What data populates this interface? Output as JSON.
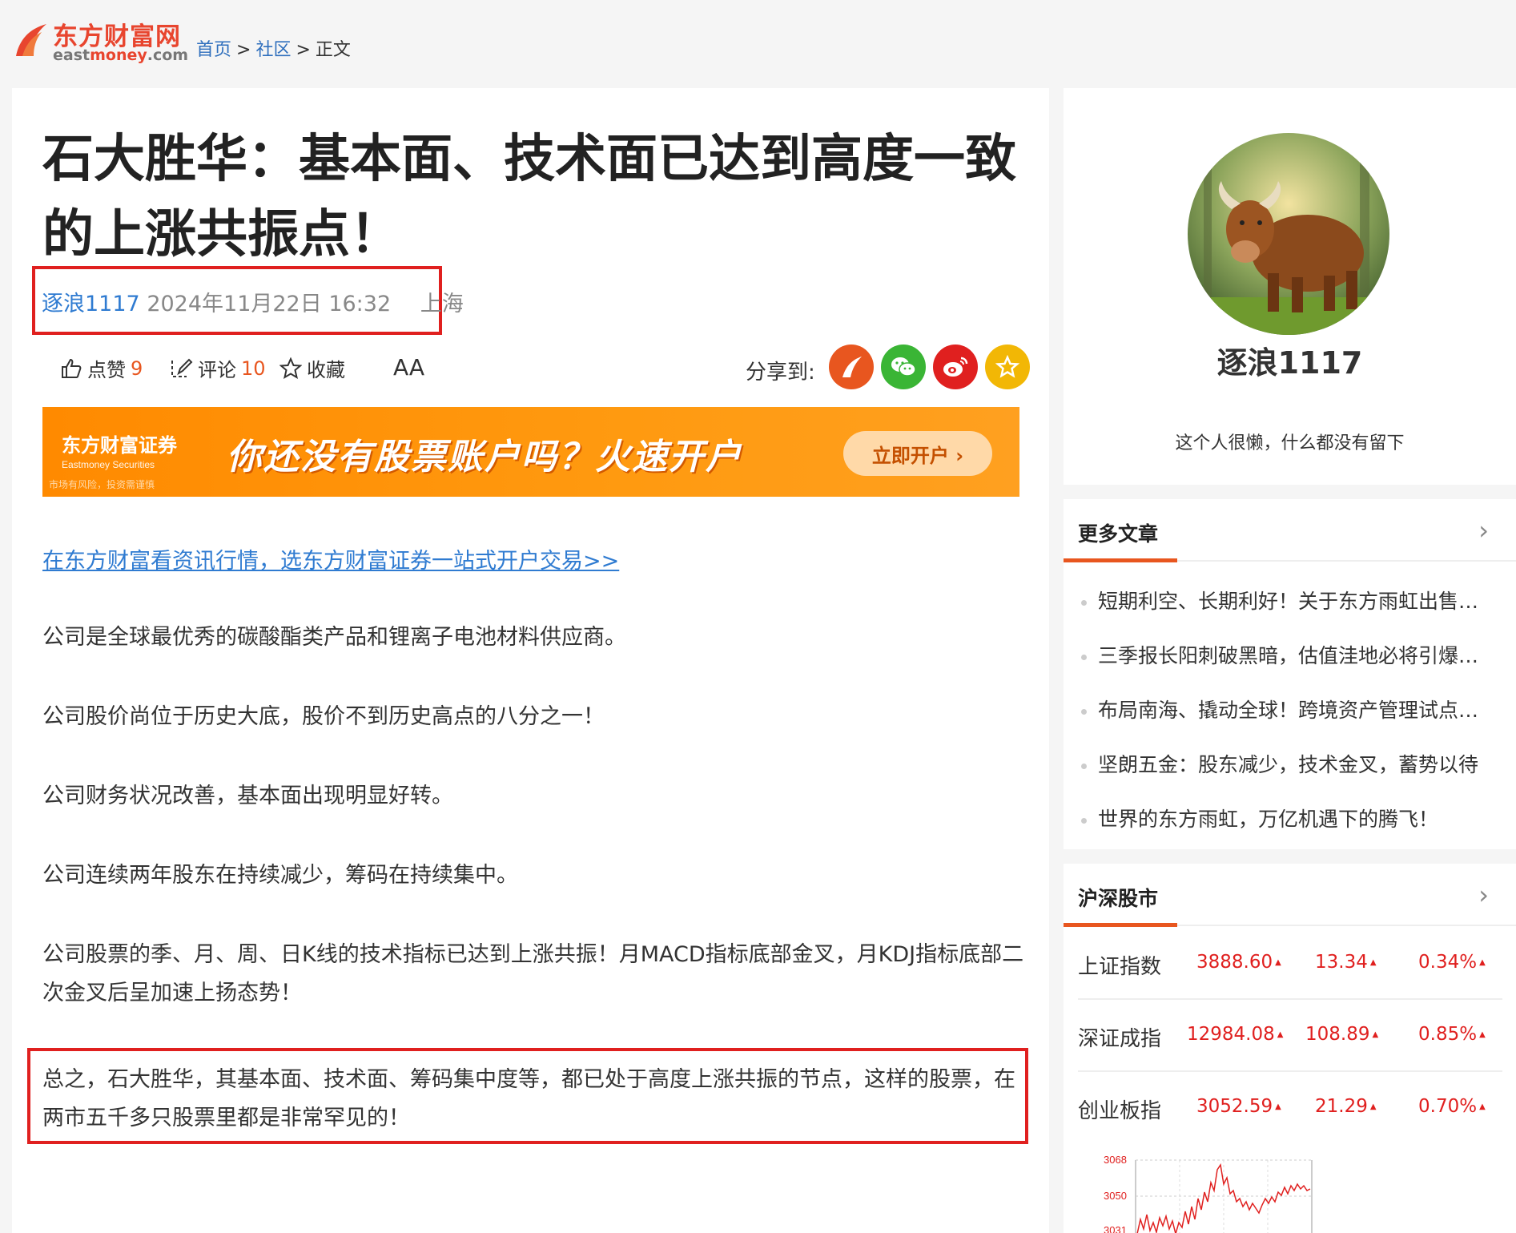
{
  "header": {
    "logo_cn": "东方财富网",
    "logo_en_a": "east",
    "logo_en_b": "money",
    "logo_en_c": ".com",
    "breadcrumb": [
      "首页",
      "社区",
      "正文"
    ]
  },
  "article": {
    "title": "石大胜华：基本面、技术面已达到高度一致的上涨共振点！",
    "author": "逐浪1117",
    "datetime": "2024年11月22日 16:32",
    "location": "上海",
    "actions": {
      "like_label": "点赞",
      "like_count": "9",
      "comment_label": "评论",
      "comment_count": "10",
      "favorite_label": "收藏",
      "font_label": "AA"
    },
    "share_label": "分享到:",
    "banner": {
      "brand": "东方财富证券",
      "brand_en": "Eastmoney Securities",
      "risk": "市场有风险，投资需谨慎",
      "slogan": "你还没有股票账户吗？火速开户",
      "button": "立即开户 ›"
    },
    "promo_link": "在东方财富看资讯行情，选东方财富证券一站式开户交易>>",
    "paragraphs": [
      "公司是全球最优秀的碳酸酯类产品和锂离子电池材料供应商。",
      "公司股价尚位于历史大底，股价不到历史高点的八分之一！",
      "公司财务状况改善，基本面出现明显好转。",
      "公司连续两年股东在持续减少，筹码在持续集中。",
      "公司股票的季、月、周、日K线的技术指标已达到上涨共振！月MACD指标底部金叉，月KDJ指标底部二次金叉后呈加速上扬态势！",
      "总之，石大胜华，其基本面、技术面、筹码集中度等，都已处于高度上涨共振的节点，这样的股票，在两市五千多只股票里都是非常罕见的！"
    ]
  },
  "profile": {
    "name": "逐浪1117",
    "bio": "这个人很懒，什么都没有留下"
  },
  "more_articles": {
    "title": "更多文章",
    "items": [
      "短期利空、长期利好！关于东方雨虹出售部分资产的深度解读",
      "三季报长阳刺破黑暗，估值洼地必将引爆行情",
      "布局南海、撬动全球！跨境资产管理试点意义重大",
      "坚朗五金：股东减少，技术金叉，蓄势以待",
      "世界的东方雨虹，万亿机遇下的腾飞！"
    ]
  },
  "market": {
    "title": "沪深股市",
    "indices": [
      {
        "name": "上证指数",
        "price": "3888.60",
        "change": "13.34",
        "pct": "0.34%"
      },
      {
        "name": "深证成指",
        "price": "12984.08",
        "change": "108.89",
        "pct": "0.85%"
      },
      {
        "name": "创业板指",
        "price": "3052.59",
        "change": "21.29",
        "pct": "0.70%"
      }
    ],
    "chart_y_labels": [
      "3068",
      "3050",
      "3031"
    ]
  },
  "colors": {
    "accent": "#e8561f",
    "link": "#2f7bd1",
    "up": "#e0201f",
    "highlight_border": "#e0201f"
  }
}
